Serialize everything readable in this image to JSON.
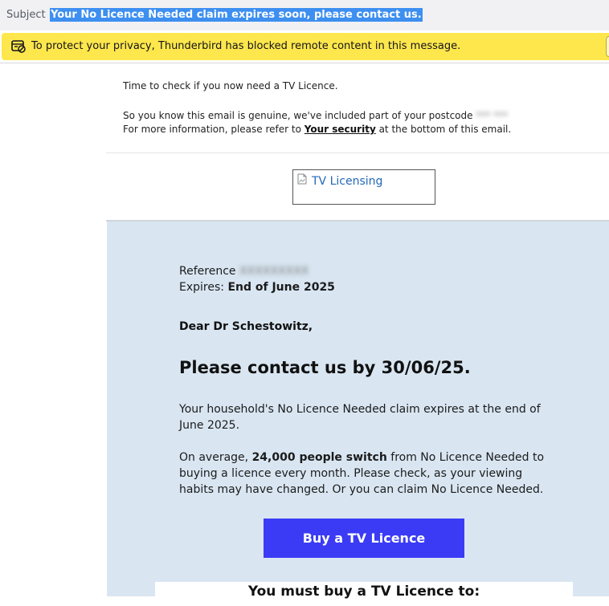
{
  "header": {
    "subject_label": "Subject",
    "subject_text": "Your No Licence Needed claim expires soon, please contact us."
  },
  "notice": {
    "icon": "blocked-content-icon",
    "text": "To protect your privacy, Thunderbird has blocked remote content in this message."
  },
  "email": {
    "intro_line1": "Time to check if you now need a TV Licence.",
    "intro_line2_prefix": "So you know this email is genuine, we've included part of your postcode",
    "postcode_redacted": "*** ***",
    "intro_line3_prefix": "For more information, please refer to ",
    "your_security_link": "Your security",
    "intro_line3_suffix": " at the bottom of this email.",
    "logo_alt": "TV Licensing",
    "reference_label": "Reference",
    "reference_redacted": "XXXXXXXXX",
    "expires_label": "Expires: ",
    "expires_value": "End of June 2025",
    "greeting": "Dear Dr Schestowitz,",
    "headline": "Please contact us by 30/06/25.",
    "para1": "Your household's No Licence Needed claim expires at the end of June 2025.",
    "para2_prefix": "On average, ",
    "para2_bold": "24,000 people switch",
    "para2_suffix": " from No Licence Needed to buying a licence every month. Please check, as your viewing habits may have changed. Or you can claim No Licence Needed.",
    "cta_label": "Buy a TV Licence",
    "must_buy_heading": "You must buy a TV Licence to:"
  },
  "colors": {
    "subject_highlight": "#3d8ff0",
    "notice_bg": "#fde74c",
    "panel_bg": "#d9e6f2",
    "cta_bg": "#3b3bf5",
    "logo_link": "#2368b8"
  }
}
